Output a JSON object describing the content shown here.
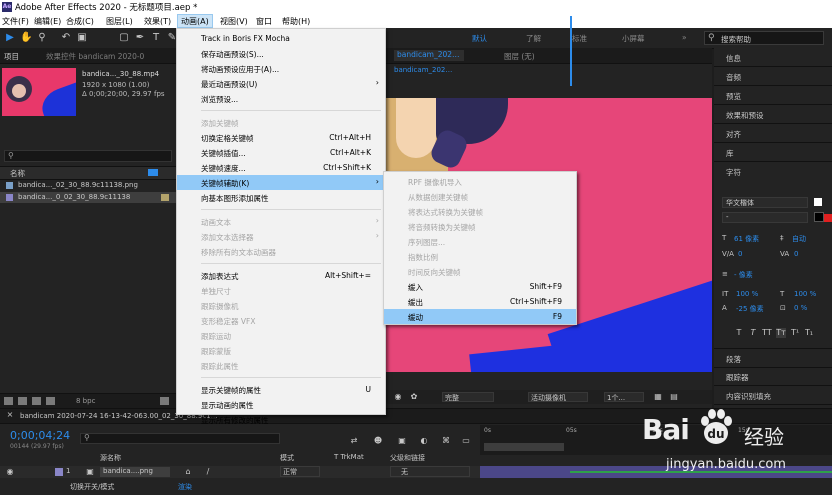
{
  "app": {
    "title": "Adobe After Effects 2020 - 无标题项目.aep *",
    "icon_text": "Ae"
  },
  "menubar": [
    {
      "label": "文件(F)",
      "active": false
    },
    {
      "label": "编辑(E)",
      "active": false
    },
    {
      "label": "合成(C)",
      "active": false
    },
    {
      "label": "图层(L)",
      "active": false
    },
    {
      "label": "效果(T)",
      "active": false
    },
    {
      "label": "动画(A)",
      "active": true
    },
    {
      "label": "视图(V)",
      "active": false
    },
    {
      "label": "窗口",
      "active": false
    },
    {
      "label": "帮助(H)",
      "active": false
    }
  ],
  "toolbar": {
    "workspaces": [
      {
        "label": "默认",
        "active": true
      },
      {
        "label": "了解",
        "active": false
      },
      {
        "label": "标准",
        "active": false
      },
      {
        "label": "小屏幕",
        "active": false
      }
    ],
    "search_placeholder": "搜索帮助"
  },
  "project": {
    "tab_label": "项目",
    "tab_label_2": "效果控件 bandicam 2020-0",
    "file_name": "bandica..._30_88.mp4",
    "file_info_1": "1920 x 1080 (1.00)",
    "file_info_2": "Δ 0;00;20;00, 29.97 fps",
    "col_name": "名称",
    "files": [
      {
        "name": "bandica..._02_30_88.9c11138.png",
        "selected": false
      },
      {
        "name": "bandica..._0_02_30_88.9c11138",
        "selected": true
      }
    ],
    "bpc": "8 bpc"
  },
  "comp": {
    "tab_label": "合成 bandicam 2020-07-24 16-13-42-063.00_02_30.88",
    "tab_short": "bandicam_2020-07_02_30_88_0c11138",
    "tab2_label": "图层 (无)",
    "ctrl_quality": "完整",
    "ctrl_camera": "活动摄像机",
    "ctrl_views": "1个..."
  },
  "menu_dropdown": {
    "items": [
      {
        "label": "Track in Boris FX Mocha",
        "shortcut": "",
        "disabled": false,
        "arrow": false,
        "highlight": false
      },
      {
        "label": "保存动画预设(S)...",
        "shortcut": "",
        "disabled": false,
        "arrow": false,
        "highlight": false
      },
      {
        "label": "将动画预设应用于(A)...",
        "shortcut": "",
        "disabled": false,
        "arrow": false,
        "highlight": false
      },
      {
        "label": "最近动画预设(U)",
        "shortcut": "",
        "disabled": false,
        "arrow": true,
        "highlight": false
      },
      {
        "label": "浏览预设...",
        "shortcut": "",
        "disabled": false,
        "arrow": false,
        "highlight": false,
        "sep_after": true
      },
      {
        "label": "添加关键帧",
        "shortcut": "",
        "disabled": true,
        "arrow": false,
        "highlight": false
      },
      {
        "label": "切换定格关键帧",
        "shortcut": "Ctrl+Alt+H",
        "disabled": false,
        "arrow": false,
        "highlight": false
      },
      {
        "label": "关键帧插值...",
        "shortcut": "Ctrl+Alt+K",
        "disabled": false,
        "arrow": false,
        "highlight": false
      },
      {
        "label": "关键帧速度...",
        "shortcut": "Ctrl+Shift+K",
        "disabled": false,
        "arrow": false,
        "highlight": false
      },
      {
        "label": "关键帧辅助(K)",
        "shortcut": "",
        "disabled": false,
        "arrow": true,
        "highlight": true
      },
      {
        "label": "向基本图形添加属性",
        "shortcut": "",
        "disabled": false,
        "arrow": false,
        "highlight": false,
        "sep_after": true
      },
      {
        "label": "动画文本",
        "shortcut": "",
        "disabled": true,
        "arrow": true,
        "highlight": false
      },
      {
        "label": "添加文本选择器",
        "shortcut": "",
        "disabled": true,
        "arrow": true,
        "highlight": false
      },
      {
        "label": "移除所有的文本动画器",
        "shortcut": "",
        "disabled": true,
        "arrow": false,
        "highlight": false,
        "sep_after": true
      },
      {
        "label": "添加表达式",
        "shortcut": "Alt+Shift+=",
        "disabled": false,
        "arrow": false,
        "highlight": false
      },
      {
        "label": "单独尺寸",
        "shortcut": "",
        "disabled": true,
        "arrow": false,
        "highlight": false
      },
      {
        "label": "跟踪摄像机",
        "shortcut": "",
        "disabled": true,
        "arrow": false,
        "highlight": false
      },
      {
        "label": "变形稳定器 VFX",
        "shortcut": "",
        "disabled": true,
        "arrow": false,
        "highlight": false
      },
      {
        "label": "跟踪运动",
        "shortcut": "",
        "disabled": true,
        "arrow": false,
        "highlight": false
      },
      {
        "label": "跟踪蒙版",
        "shortcut": "",
        "disabled": true,
        "arrow": false,
        "highlight": false
      },
      {
        "label": "跟踪此属性",
        "shortcut": "",
        "disabled": true,
        "arrow": false,
        "highlight": false,
        "sep_after": true
      },
      {
        "label": "显示关键帧的属性",
        "shortcut": "U",
        "disabled": false,
        "arrow": false,
        "highlight": false
      },
      {
        "label": "显示动画的属性",
        "shortcut": "",
        "disabled": false,
        "arrow": false,
        "highlight": false
      },
      {
        "label": "显示所有修改的属性",
        "shortcut": "",
        "disabled": false,
        "arrow": false,
        "highlight": false
      }
    ]
  },
  "submenu": {
    "items": [
      {
        "label": "RPF 摄像机导入",
        "shortcut": "",
        "disabled": true,
        "highlight": false
      },
      {
        "label": "从数据创建关键帧",
        "shortcut": "",
        "disabled": true,
        "highlight": false
      },
      {
        "label": "将表达式转换为关键帧",
        "shortcut": "",
        "disabled": true,
        "highlight": false
      },
      {
        "label": "将音频转换为关键帧",
        "shortcut": "",
        "disabled": true,
        "highlight": false
      },
      {
        "label": "序列图层...",
        "shortcut": "",
        "disabled": true,
        "highlight": false
      },
      {
        "label": "指数比例",
        "shortcut": "",
        "disabled": true,
        "highlight": false
      },
      {
        "label": "时间反向关键帧",
        "shortcut": "",
        "disabled": true,
        "highlight": false
      },
      {
        "label": "缓入",
        "shortcut": "Shift+F9",
        "disabled": false,
        "highlight": false
      },
      {
        "label": "缓出",
        "shortcut": "Ctrl+Shift+F9",
        "disabled": false,
        "highlight": false
      },
      {
        "label": "缓动",
        "shortcut": "F9",
        "disabled": false,
        "highlight": true
      }
    ]
  },
  "right_panel": {
    "panels": [
      "信息",
      "音频",
      "预览",
      "效果和预设",
      "对齐",
      "库",
      "字符"
    ],
    "font_name": "华文楷体",
    "font_style": "-",
    "font_size": "61 像素",
    "leading": "自动",
    "kerning": "0",
    "tracking": "0",
    "stroke": "- 像素",
    "vscale": "100 %",
    "hscale": "100 %",
    "baseline": "-25 像素",
    "tsume": "0 %",
    "bottom_panels": [
      "段落",
      "跟踪器",
      "内容识别填充"
    ]
  },
  "timeline": {
    "tab_label": "bandicam 2020-07-24 16-13-42-063.00_02_30_88.9c11138",
    "timecode": "0;00;04;24",
    "fps": "00144 (29.97 fps)",
    "col_source": "源名称",
    "col_mode": "模式",
    "col_trkmat": "T TrkMat",
    "col_parent": "父级和链接",
    "layer_num": "1",
    "layer_name": "bandica....png",
    "layer_mode": "正常",
    "layer_parent": "无",
    "ruler_labels": [
      "0s",
      "05s",
      "10s",
      "15s"
    ],
    "bottom_toggle": "切换开关/模式",
    "bottom_label": "渲染"
  },
  "watermark": {
    "brand": "Bai",
    "brand2": "经验",
    "url": "jingyan.baidu.com"
  },
  "colors": {
    "accent": "#2d8ceb",
    "menu_highlight": "#91c9f7",
    "canvas_pink": "#e64679",
    "canvas_blue": "#1e30e0"
  }
}
